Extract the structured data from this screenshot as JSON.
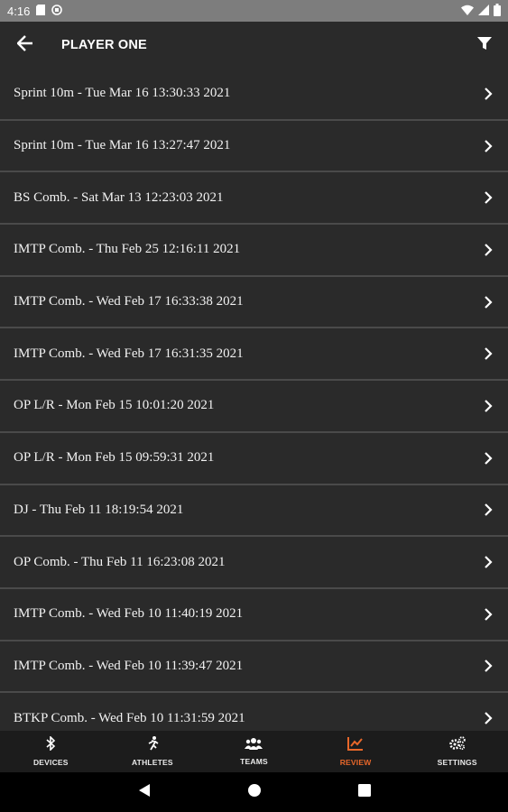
{
  "status_bar": {
    "time": "4:16",
    "icons": [
      "sd-card-icon",
      "vpn-icon",
      "wifi-icon",
      "signal-icon",
      "battery-icon"
    ]
  },
  "app_bar": {
    "title": "PLAYER ONE",
    "back_icon": "arrow-left-icon",
    "filter_icon": "filter-icon"
  },
  "sessions": [
    {
      "label": "Sprint 10m - Tue Mar 16 13:30:33 2021"
    },
    {
      "label": "Sprint 10m - Tue Mar 16 13:27:47 2021"
    },
    {
      "label": "BS Comb. - Sat Mar 13 12:23:03 2021"
    },
    {
      "label": "IMTP Comb. - Thu Feb 25 12:16:11 2021"
    },
    {
      "label": "IMTP Comb. - Wed Feb 17 16:33:38 2021"
    },
    {
      "label": "IMTP Comb. - Wed Feb 17 16:31:35 2021"
    },
    {
      "label": "OP L/R - Mon Feb 15 10:01:20 2021"
    },
    {
      "label": "OP L/R - Mon Feb 15 09:59:31 2021"
    },
    {
      "label": "DJ - Thu Feb 11 18:19:54 2021"
    },
    {
      "label": "OP Comb. - Thu Feb 11 16:23:08 2021"
    },
    {
      "label": "IMTP Comb. - Wed Feb 10 11:40:19 2021"
    },
    {
      "label": "IMTP Comb. - Wed Feb 10 11:39:47 2021"
    },
    {
      "label": "BTKP Comb. - Wed Feb 10 11:31:59 2021"
    }
  ],
  "bottom_nav": {
    "items": [
      {
        "label": "DEVICES",
        "icon": "bluetooth-icon"
      },
      {
        "label": "ATHLETES",
        "icon": "running-person-icon"
      },
      {
        "label": "TEAMS",
        "icon": "users-icon"
      },
      {
        "label": "REVIEW",
        "icon": "chart-line-icon",
        "active": true
      },
      {
        "label": "SETTINGS",
        "icon": "gears-icon"
      }
    ]
  },
  "colors": {
    "background": "#2a2a2a",
    "accent": "#e8672a",
    "status_bar": "#7d7d7d",
    "nav_bar": "#1c1c1c",
    "divider": "#4a4a4a"
  }
}
